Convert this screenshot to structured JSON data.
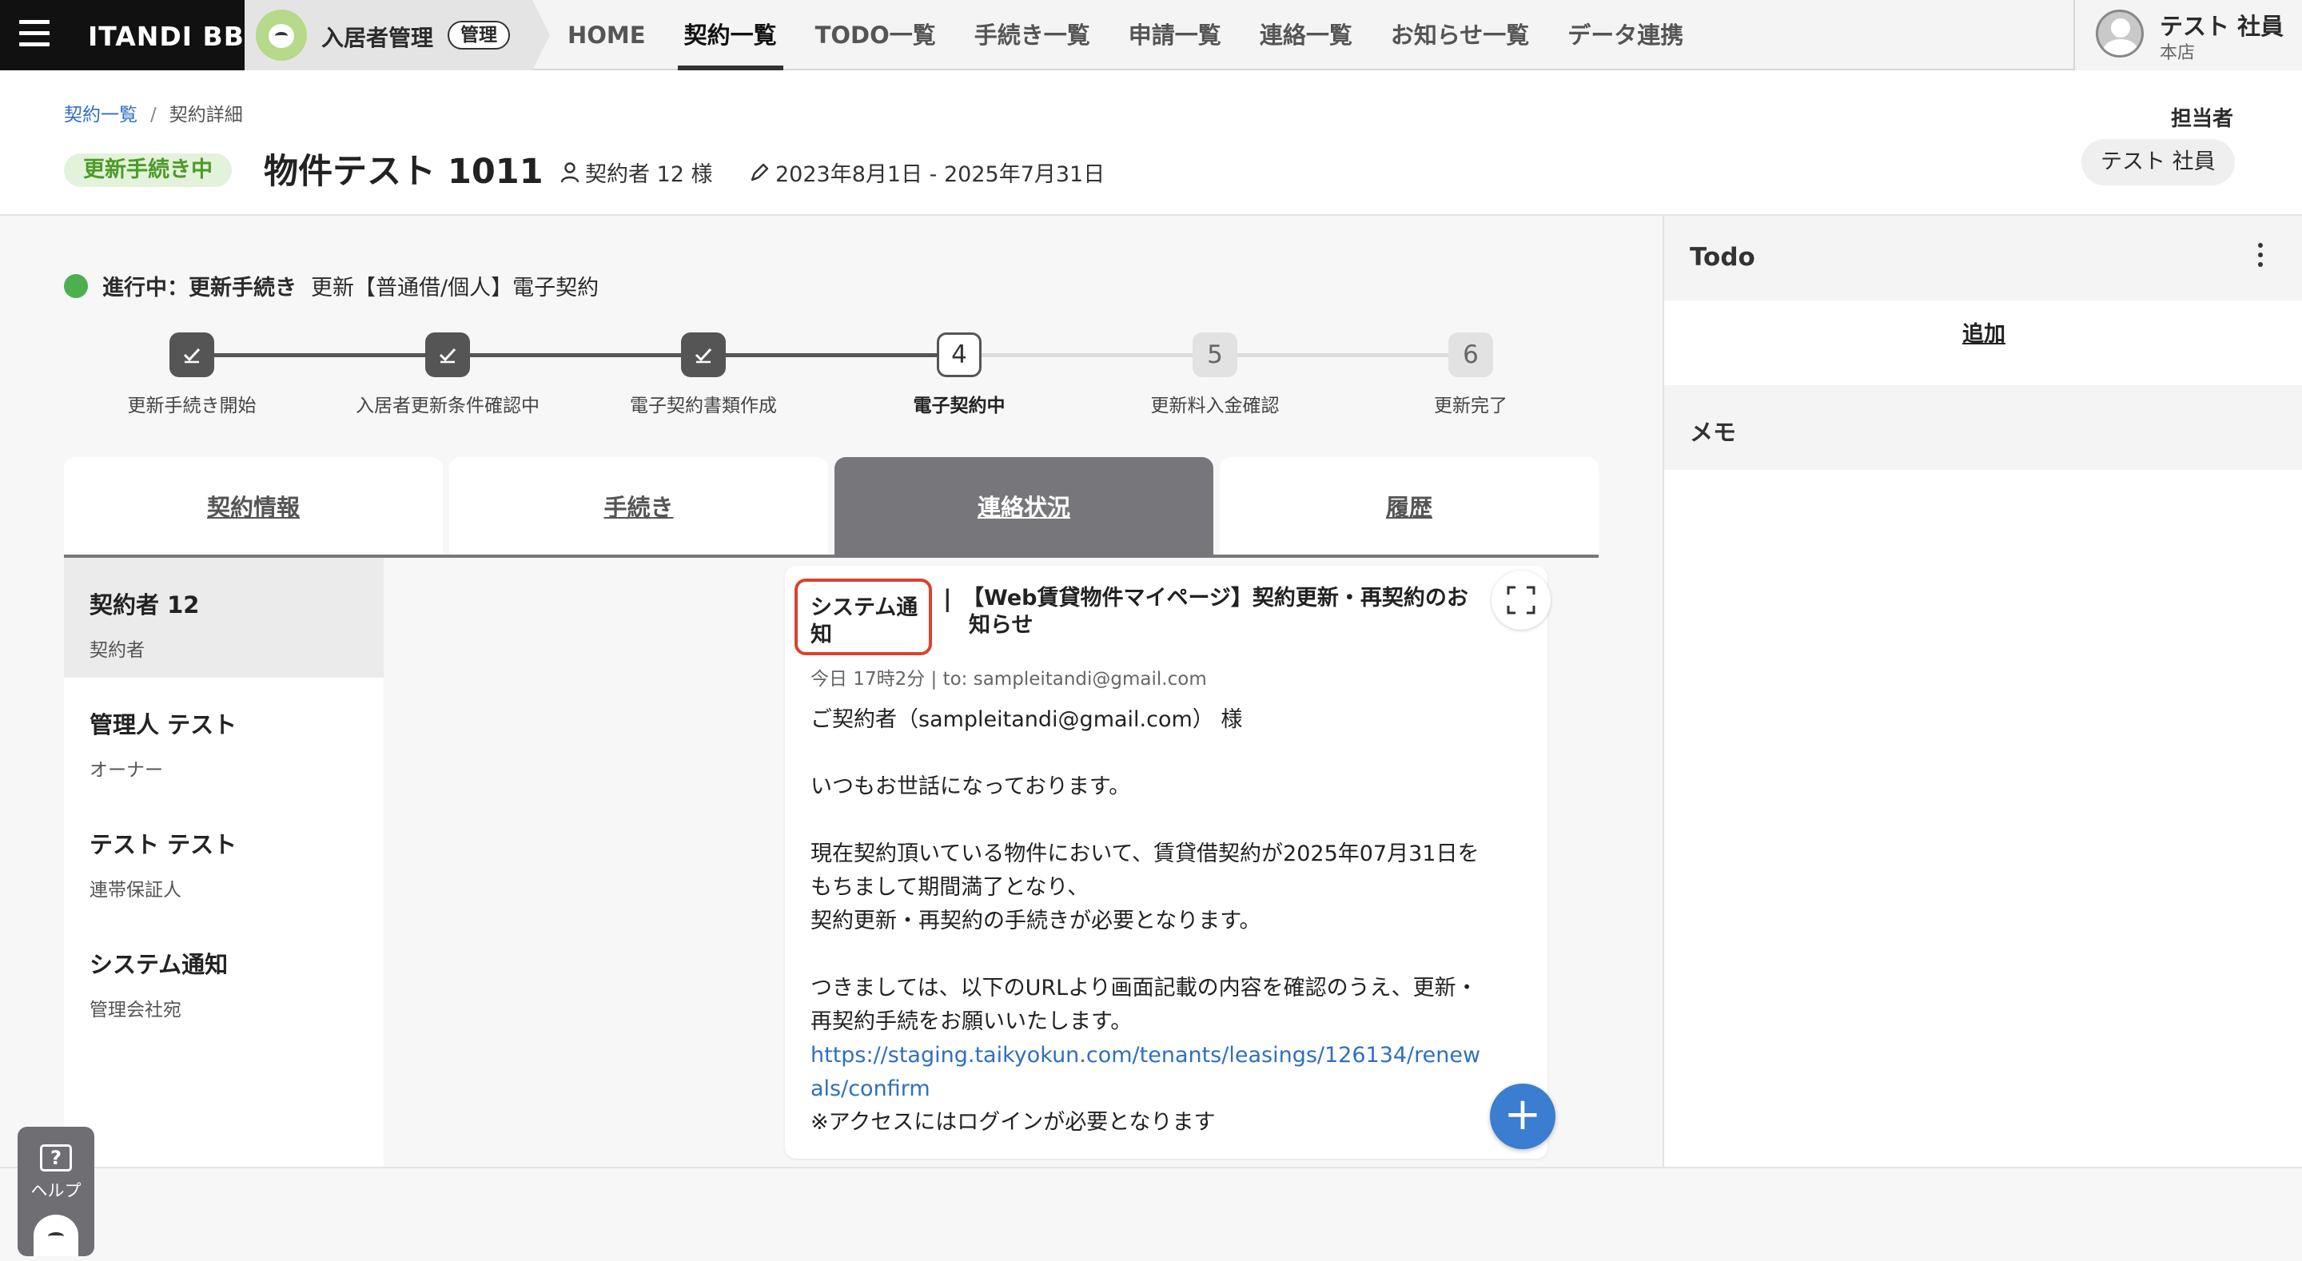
{
  "topbar": {
    "brand": "ITANDI BB",
    "app_name": "入居者管理",
    "app_badge": "管理",
    "nav": [
      "HOME",
      "契約一覧",
      "TODO一覧",
      "手続き一覧",
      "申請一覧",
      "連絡一覧",
      "お知らせ一覧",
      "データ連携"
    ],
    "nav_active": "契約一覧",
    "user_name": "テスト 社員",
    "user_branch": "本店"
  },
  "header": {
    "breadcrumb_link": "契約一覧",
    "breadcrumb_sep": "/",
    "breadcrumb_current": "契約詳細",
    "status": "更新手続き中",
    "property_title": "物件テスト 1011",
    "contractor": "契約者 12 様",
    "period": "2023年8月1日 - 2025年7月31日",
    "assignee_label": "担当者",
    "assignee": "テスト 社員"
  },
  "progress": {
    "status_prefix": "進行中：更新手続き",
    "status_detail": "更新【普通借/個人】電子契約",
    "steps": [
      {
        "number": "1",
        "label": "更新手続き開始",
        "state": "done"
      },
      {
        "number": "2",
        "label": "入居者更新条件確認中",
        "state": "done"
      },
      {
        "number": "3",
        "label": "電子契約書類作成",
        "state": "done"
      },
      {
        "number": "4",
        "label": "電子契約中",
        "state": "current"
      },
      {
        "number": "5",
        "label": "更新料入金確認",
        "state": "future"
      },
      {
        "number": "6",
        "label": "更新完了",
        "state": "future"
      }
    ]
  },
  "tabs": [
    "契約情報",
    "手続き",
    "連絡状況",
    "履歴"
  ],
  "tab_active": "連絡状況",
  "contacts": [
    {
      "name": "契約者 12",
      "role": "契約者"
    },
    {
      "name": "管理人 テスト",
      "role": "オーナー"
    },
    {
      "name": "テスト テスト",
      "role": "連帯保証人"
    },
    {
      "name": "システム通知",
      "role": "管理会社宛"
    }
  ],
  "message": {
    "sender_line1": "システム通",
    "sender_line2": "知",
    "pipe": "|",
    "subject_line1": "【Web賃貸物件マイページ】契約更新・再契約のお",
    "subject_line2": "知らせ",
    "meta": "今日 17時2分  |  to: sampleitandi@gmail.com",
    "body": {
      "greeting": "ご契約者（sampleitandi@gmail.com） 様",
      "p1": "いつもお世話になっております。",
      "p2_l1": "現在契約頂いている物件において、賃貸借契約が2025年07月31日を",
      "p2_l2": "もちまして期間満了となり、",
      "p2_l3": "契約更新・再契約の手続きが必要となります。",
      "p3_l1": "つきましては、以下のURLより画面記載の内容を確認のうえ、更新・",
      "p3_l2": "再契約手続をお願いいたします。",
      "url_l1": "https://staging.taikyokun.com/tenants/leasings/126134/renew",
      "url_l2": "als/confirm",
      "note": "※アクセスにはログインが必要となります"
    }
  },
  "right_panel": {
    "todo_title": "Todo",
    "todo_add": "追加",
    "memo_title": "メモ"
  },
  "help": {
    "label": "ヘルプ",
    "icon_text": "?"
  },
  "colors": {
    "status_green": "#4caf50",
    "accent_blue": "#3b7dd0",
    "highlight_red": "#d9422e",
    "tab_active": "#77777b"
  }
}
